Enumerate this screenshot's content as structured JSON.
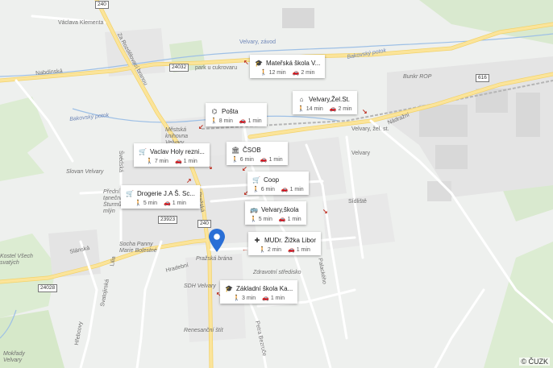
{
  "map": {
    "copyright": "© ČUZK",
    "road_numbers": {
      "r240_top": "240",
      "r24032": "24032",
      "r616": "616",
      "r240_mid": "240",
      "r23923": "23923",
      "r24028": "24028"
    },
    "street_labels": {
      "vaclava_klementa": "Václava Klementa",
      "za_rozdelovaci_branou": "Za Rozdělovací branou",
      "nabdinska": "Nabdínská",
      "bakovsky_potok_1": "Bakovský potok",
      "bakovsky_potok_2": "Bakovský potok",
      "park_u_cukrovaru": "park u cukrovaru",
      "bunkr_rop": "Bunkr ROP",
      "nadrazni": "Nádražní",
      "velvary_zel_st": "Velvary, žel. st.",
      "velvary_poi": "Velvary",
      "velvary_zavod": "Velvary, závod",
      "mestska_knihovna": "Městská knihovna Velvary",
      "slovan_velvary": "Slovan Velvary",
      "predni_tanecnice": "Přední taneční Šturmův mlýn",
      "svedska": "Švédská",
      "sidliste": "Sídliště",
      "slanska": "Slánská",
      "socha_panny": "Socha Panny Marie Bolestné",
      "kostel": "Kostel Všech svatých",
      "hradebni": "Hradební",
      "prazska_brana": "Pražská brána",
      "sdh_velvary": "SDH Velvary",
      "zdravotni_stredisko": "Zdravotní středisko",
      "rerasancni": "Renesanční štít",
      "svatojirska": "Svatojirská",
      "lilia": "Lilia",
      "prazska": "Pražská",
      "pratska_ulice": "Palackého",
      "petra_bezruce": "Petra Bezruče",
      "mokrady": "Mokřady Velvary",
      "hrebcovy": "Hřebcovy"
    },
    "cards": [
      {
        "icon": "school-icon",
        "glyph": "🎓",
        "name": "Mateřská škola V...",
        "walk": "12 min",
        "drive": "2 min"
      },
      {
        "icon": "building-icon",
        "glyph": "⌂",
        "name": "Velvary,Žel.St.",
        "walk": "14 min",
        "drive": "2 min"
      },
      {
        "icon": "post-icon",
        "glyph": "⌬",
        "name": "Pošta",
        "walk": "8 min",
        "drive": "1 min"
      },
      {
        "icon": "cart-icon",
        "glyph": "🛒",
        "name": "Vaclav Holy rezni...",
        "walk": "7 min",
        "drive": "1 min"
      },
      {
        "icon": "bank-icon",
        "glyph": "🏛",
        "name": "ČSOB",
        "walk": "6 min",
        "drive": "1 min"
      },
      {
        "icon": "cart-icon",
        "glyph": "🛒",
        "name": "Coop",
        "walk": "6 min",
        "drive": "1 min"
      },
      {
        "icon": "cart-icon",
        "glyph": "🛒",
        "name": "Drogerie J.A Š. Sc...",
        "walk": "5 min",
        "drive": "1 min"
      },
      {
        "icon": "bus-icon",
        "glyph": "🚌",
        "name": "Velvary,škola",
        "walk": "5 min",
        "drive": "1 min"
      },
      {
        "icon": "medical-icon",
        "glyph": "✚",
        "name": "MUDr. Žižka Libor",
        "walk": "2 min",
        "drive": "1 min"
      },
      {
        "icon": "school-icon",
        "glyph": "🎓",
        "name": "Základní škola Ka...",
        "walk": "3 min",
        "drive": "1 min"
      }
    ],
    "colors": {
      "pin": "#2a6fd6",
      "arrow": "#c0392b",
      "water": "#9ec0e6",
      "road": "#ffffff",
      "road_major": "#fbe49a"
    }
  }
}
